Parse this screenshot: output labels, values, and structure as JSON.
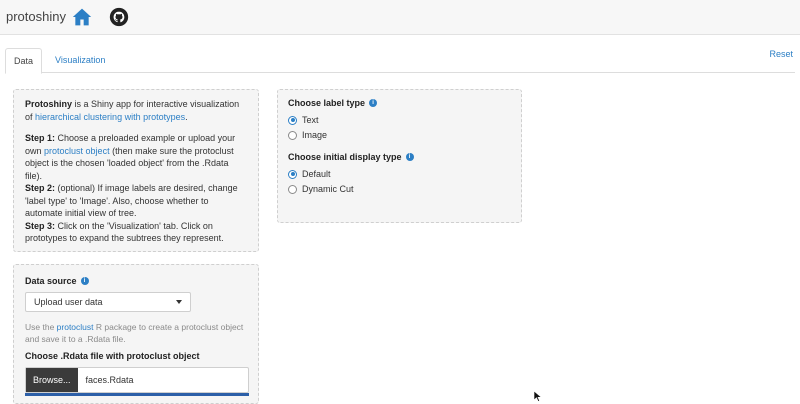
{
  "navbar": {
    "brand": "protoshiny",
    "home_icon": "home-icon",
    "github_icon": "github-icon"
  },
  "tabs": [
    {
      "label": "Data",
      "active": true
    },
    {
      "label": "Visualization",
      "active": false
    }
  ],
  "reset_label": "Reset",
  "intro": {
    "brand": "Protoshiny",
    "desc_pre": " is a Shiny app for interactive visualization of",
    "desc_link": "hierarchical clustering with prototypes",
    "desc_post": ".",
    "step1_label": "Step 1:",
    "step1_text_a": " Choose a preloaded example or upload your own",
    "step1_link": "protoclust object",
    "step1_text_b": " (then make sure the protoclust object is the chosen 'loaded object' from the .Rdata file).",
    "step2_label": "Step 2:",
    "step2_text": " (optional) If image labels are desired, change 'label type' to 'Image'. Also, choose whether to automate initial view of tree.",
    "step3_label": "Step 3:",
    "step3_text": " Click on the 'Visualization' tab. Click on prototypes to expand the subtrees they represent."
  },
  "label_type": {
    "title": "Choose label type",
    "options": [
      "Text",
      "Image"
    ],
    "selected": "Text"
  },
  "display_type": {
    "title": "Choose initial display type",
    "options": [
      "Default",
      "Dynamic Cut"
    ],
    "selected": "Default"
  },
  "data_source": {
    "title": "Data source",
    "select_value": "Upload user data",
    "help_pre": "Use the ",
    "help_link": "protoclust",
    "help_post": " R package to create a protoclust object and save it to a .Rdata file.",
    "file_label": "Choose .Rdata file with protoclust object",
    "browse_label": "Browse...",
    "file_name": "faces.Rdata",
    "upload_progress": 1.0
  },
  "colors": {
    "accent": "#2c7fc5",
    "navbar_bg": "#f7f7f7",
    "well_bg": "#f5f5f5",
    "browse_bg": "#3b3b3b"
  }
}
